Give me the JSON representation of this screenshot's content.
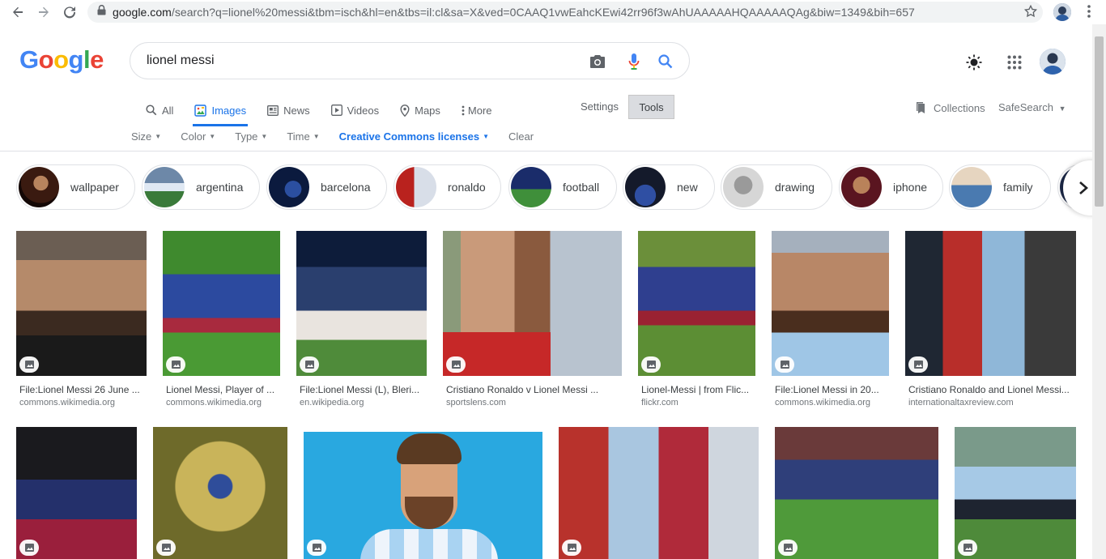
{
  "browser": {
    "url_host": "google.com",
    "url_rest": "/search?q=lionel%20messi&tbm=isch&hl=en&tbs=il:cl&sa=X&ved=0CAAQ1vwEahcKEwi42rr96f3wAhUAAAAAHQAAAAAQAg&biw=1349&bih=657"
  },
  "search": {
    "query": "lionel messi"
  },
  "tabs": [
    {
      "label": "All",
      "icon": "search-icon"
    },
    {
      "label": "Images",
      "icon": "image-icon"
    },
    {
      "label": "News",
      "icon": "news-icon"
    },
    {
      "label": "Videos",
      "icon": "video-icon"
    },
    {
      "label": "Maps",
      "icon": "map-pin-icon"
    },
    {
      "label": "More",
      "icon": "more-vert-icon"
    }
  ],
  "settings_label": "Settings",
  "tools_label": "Tools",
  "collections_label": "Collections",
  "safesearch_label": "SafeSearch",
  "filters": [
    {
      "label": "Size"
    },
    {
      "label": "Color"
    },
    {
      "label": "Type"
    },
    {
      "label": "Time"
    },
    {
      "label": "Creative Commons licenses"
    },
    {
      "label": "Clear"
    }
  ],
  "chips": [
    {
      "label": "wallpaper"
    },
    {
      "label": "argentina"
    },
    {
      "label": "barcelona"
    },
    {
      "label": "ronaldo"
    },
    {
      "label": "football"
    },
    {
      "label": "new"
    },
    {
      "label": "drawing"
    },
    {
      "label": "iphone"
    },
    {
      "label": "family"
    }
  ],
  "results": [
    {
      "title": "File:Lionel Messi 26 June ...",
      "source": "commons.wikimedia.org"
    },
    {
      "title": "Lionel Messi, Player of ...",
      "source": "commons.wikimedia.org"
    },
    {
      "title": "File:Lionel Messi (L), Bleri...",
      "source": "en.wikipedia.org"
    },
    {
      "title": "Cristiano Ronaldo v Lionel Messi ...",
      "source": "sportslens.com"
    },
    {
      "title": "Lionel-Messi | from Flic...",
      "source": "flickr.com"
    },
    {
      "title": "File:Lionel Messi in 20...",
      "source": "commons.wikimedia.org"
    },
    {
      "title": "Cristiano Ronaldo and Lionel Messi...",
      "source": "internationaltaxreview.com"
    }
  ],
  "colors": {
    "accent": "#1a73e8",
    "google_blue": "#4285f4",
    "google_red": "#ea4335",
    "google_yellow": "#fbbc05",
    "google_green": "#34a853"
  }
}
